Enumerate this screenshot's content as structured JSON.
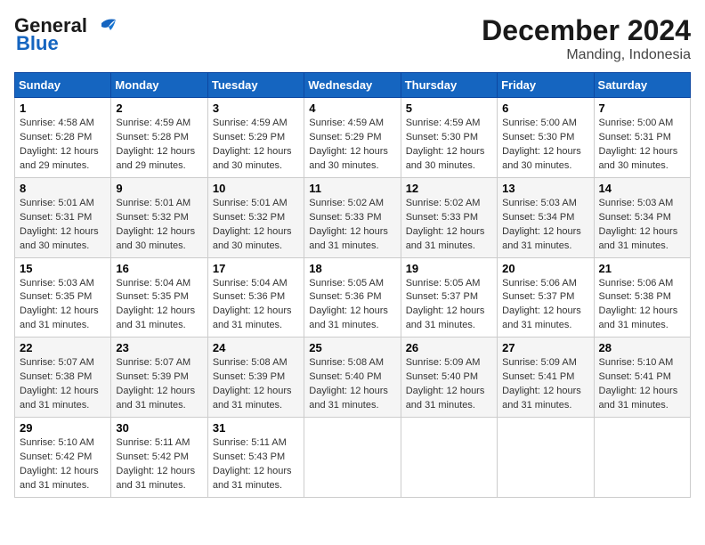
{
  "header": {
    "logo_line1": "General",
    "logo_line2": "Blue",
    "month": "December 2024",
    "location": "Manding, Indonesia"
  },
  "weekdays": [
    "Sunday",
    "Monday",
    "Tuesday",
    "Wednesday",
    "Thursday",
    "Friday",
    "Saturday"
  ],
  "weeks": [
    [
      {
        "day": "1",
        "sunrise": "4:58 AM",
        "sunset": "5:28 PM",
        "daylight": "12 hours and 29 minutes."
      },
      {
        "day": "2",
        "sunrise": "4:59 AM",
        "sunset": "5:28 PM",
        "daylight": "12 hours and 29 minutes."
      },
      {
        "day": "3",
        "sunrise": "4:59 AM",
        "sunset": "5:29 PM",
        "daylight": "12 hours and 30 minutes."
      },
      {
        "day": "4",
        "sunrise": "4:59 AM",
        "sunset": "5:29 PM",
        "daylight": "12 hours and 30 minutes."
      },
      {
        "day": "5",
        "sunrise": "4:59 AM",
        "sunset": "5:30 PM",
        "daylight": "12 hours and 30 minutes."
      },
      {
        "day": "6",
        "sunrise": "5:00 AM",
        "sunset": "5:30 PM",
        "daylight": "12 hours and 30 minutes."
      },
      {
        "day": "7",
        "sunrise": "5:00 AM",
        "sunset": "5:31 PM",
        "daylight": "12 hours and 30 minutes."
      }
    ],
    [
      {
        "day": "8",
        "sunrise": "5:01 AM",
        "sunset": "5:31 PM",
        "daylight": "12 hours and 30 minutes."
      },
      {
        "day": "9",
        "sunrise": "5:01 AM",
        "sunset": "5:32 PM",
        "daylight": "12 hours and 30 minutes."
      },
      {
        "day": "10",
        "sunrise": "5:01 AM",
        "sunset": "5:32 PM",
        "daylight": "12 hours and 30 minutes."
      },
      {
        "day": "11",
        "sunrise": "5:02 AM",
        "sunset": "5:33 PM",
        "daylight": "12 hours and 31 minutes."
      },
      {
        "day": "12",
        "sunrise": "5:02 AM",
        "sunset": "5:33 PM",
        "daylight": "12 hours and 31 minutes."
      },
      {
        "day": "13",
        "sunrise": "5:03 AM",
        "sunset": "5:34 PM",
        "daylight": "12 hours and 31 minutes."
      },
      {
        "day": "14",
        "sunrise": "5:03 AM",
        "sunset": "5:34 PM",
        "daylight": "12 hours and 31 minutes."
      }
    ],
    [
      {
        "day": "15",
        "sunrise": "5:03 AM",
        "sunset": "5:35 PM",
        "daylight": "12 hours and 31 minutes."
      },
      {
        "day": "16",
        "sunrise": "5:04 AM",
        "sunset": "5:35 PM",
        "daylight": "12 hours and 31 minutes."
      },
      {
        "day": "17",
        "sunrise": "5:04 AM",
        "sunset": "5:36 PM",
        "daylight": "12 hours and 31 minutes."
      },
      {
        "day": "18",
        "sunrise": "5:05 AM",
        "sunset": "5:36 PM",
        "daylight": "12 hours and 31 minutes."
      },
      {
        "day": "19",
        "sunrise": "5:05 AM",
        "sunset": "5:37 PM",
        "daylight": "12 hours and 31 minutes."
      },
      {
        "day": "20",
        "sunrise": "5:06 AM",
        "sunset": "5:37 PM",
        "daylight": "12 hours and 31 minutes."
      },
      {
        "day": "21",
        "sunrise": "5:06 AM",
        "sunset": "5:38 PM",
        "daylight": "12 hours and 31 minutes."
      }
    ],
    [
      {
        "day": "22",
        "sunrise": "5:07 AM",
        "sunset": "5:38 PM",
        "daylight": "12 hours and 31 minutes."
      },
      {
        "day": "23",
        "sunrise": "5:07 AM",
        "sunset": "5:39 PM",
        "daylight": "12 hours and 31 minutes."
      },
      {
        "day": "24",
        "sunrise": "5:08 AM",
        "sunset": "5:39 PM",
        "daylight": "12 hours and 31 minutes."
      },
      {
        "day": "25",
        "sunrise": "5:08 AM",
        "sunset": "5:40 PM",
        "daylight": "12 hours and 31 minutes."
      },
      {
        "day": "26",
        "sunrise": "5:09 AM",
        "sunset": "5:40 PM",
        "daylight": "12 hours and 31 minutes."
      },
      {
        "day": "27",
        "sunrise": "5:09 AM",
        "sunset": "5:41 PM",
        "daylight": "12 hours and 31 minutes."
      },
      {
        "day": "28",
        "sunrise": "5:10 AM",
        "sunset": "5:41 PM",
        "daylight": "12 hours and 31 minutes."
      }
    ],
    [
      {
        "day": "29",
        "sunrise": "5:10 AM",
        "sunset": "5:42 PM",
        "daylight": "12 hours and 31 minutes."
      },
      {
        "day": "30",
        "sunrise": "5:11 AM",
        "sunset": "5:42 PM",
        "daylight": "12 hours and 31 minutes."
      },
      {
        "day": "31",
        "sunrise": "5:11 AM",
        "sunset": "5:43 PM",
        "daylight": "12 hours and 31 minutes."
      },
      null,
      null,
      null,
      null
    ]
  ]
}
